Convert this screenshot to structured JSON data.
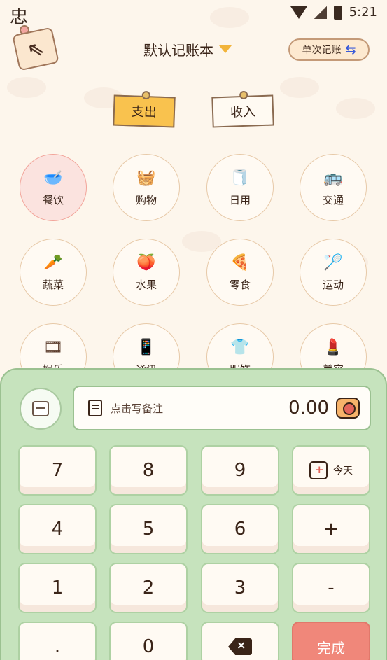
{
  "status": {
    "app_glyph": "忠",
    "time": "5:21"
  },
  "header": {
    "book_title": "默认记账本",
    "mode_label": "单次记账",
    "mode_icon": "⇆",
    "back_icon": "⇖"
  },
  "type_tabs": [
    {
      "label": "支出",
      "active": true
    },
    {
      "label": "收入",
      "active": false
    }
  ],
  "categories": [
    {
      "label": "餐饮",
      "icon": "meal-icon",
      "glyph": "🥣",
      "active": true
    },
    {
      "label": "购物",
      "icon": "basket-icon",
      "glyph": "🧺"
    },
    {
      "label": "日用",
      "icon": "tissue-icon",
      "glyph": "🧻"
    },
    {
      "label": "交通",
      "icon": "bus-icon",
      "glyph": "🚌"
    },
    {
      "label": "蔬菜",
      "icon": "carrot-icon",
      "glyph": "🥕"
    },
    {
      "label": "水果",
      "icon": "peach-icon",
      "glyph": "🍑"
    },
    {
      "label": "零食",
      "icon": "pizza-icon",
      "glyph": "🍕"
    },
    {
      "label": "运动",
      "icon": "shuttlecock-icon",
      "glyph": "🏸"
    },
    {
      "label": "娱乐",
      "icon": "film-reel-icon",
      "glyph": "🎞"
    },
    {
      "label": "通讯",
      "icon": "phone-icon",
      "glyph": "📱"
    },
    {
      "label": "服饰",
      "icon": "shirt-icon",
      "glyph": "👕"
    },
    {
      "label": "美容",
      "icon": "lipstick-mirror-icon",
      "glyph": "💄"
    }
  ],
  "entry": {
    "note_placeholder": "点击写备注",
    "amount": "0.00"
  },
  "keypad": {
    "rows": [
      [
        "7",
        "8",
        "9",
        "今天"
      ],
      [
        "4",
        "5",
        "6",
        "+"
      ],
      [
        "1",
        "2",
        "3",
        "-"
      ],
      [
        ".",
        "0",
        "",
        "完成"
      ]
    ]
  },
  "colors": {
    "expense_tab": "#f9c24e",
    "panel": "#c6e3bd",
    "done_key": "#f0877a",
    "active_category": "#fbe3df"
  }
}
